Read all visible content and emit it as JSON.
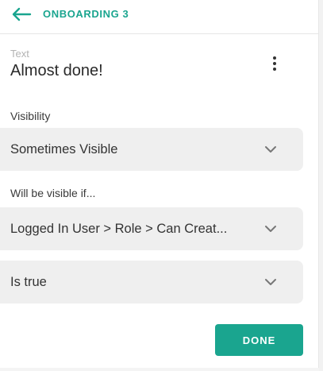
{
  "header": {
    "title": "ONBOARDING 3",
    "back_icon": "arrow-left-icon",
    "accent_color": "#1aa58f"
  },
  "element": {
    "type_label": "Text",
    "name": "Almost done!",
    "more_icon": "more-vertical-icon"
  },
  "visibility": {
    "label": "Visibility",
    "selected": "Sometimes Visible"
  },
  "condition": {
    "label": "Will be visible if...",
    "source_selected": "Logged In User > Role > Can Creat...",
    "operator_selected": "Is true"
  },
  "actions": {
    "done_label": "DONE"
  }
}
